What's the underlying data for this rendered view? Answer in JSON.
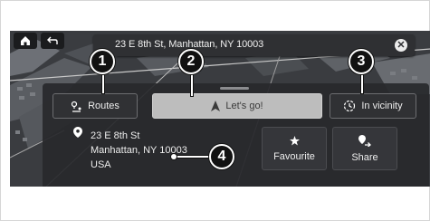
{
  "address_bar": {
    "text": "23 E 8th St, Manhattan, NY 10003"
  },
  "buttons": {
    "routes": "Routes",
    "go": "Let's go!",
    "vicinity": "In vicinity"
  },
  "destination": {
    "line1": "23 E 8th St",
    "line2": "Manhattan, NY 10003",
    "line3": "USA"
  },
  "actions": {
    "favourite": "Favourite",
    "share": "Share"
  },
  "callouts": [
    "1",
    "2",
    "3",
    "4"
  ],
  "icons": {
    "home": "home-icon",
    "back": "back-arrow-icon",
    "close": "close-icon",
    "routes": "routes-icon",
    "navigate": "navigation-arrow-icon",
    "vicinity": "vicinity-search-icon",
    "pin": "location-pin-icon",
    "star": "star-icon",
    "share": "share-icon"
  },
  "colors": {
    "panel": "#28292c",
    "go_button": "#bdbdbd",
    "callout": "#111111"
  }
}
